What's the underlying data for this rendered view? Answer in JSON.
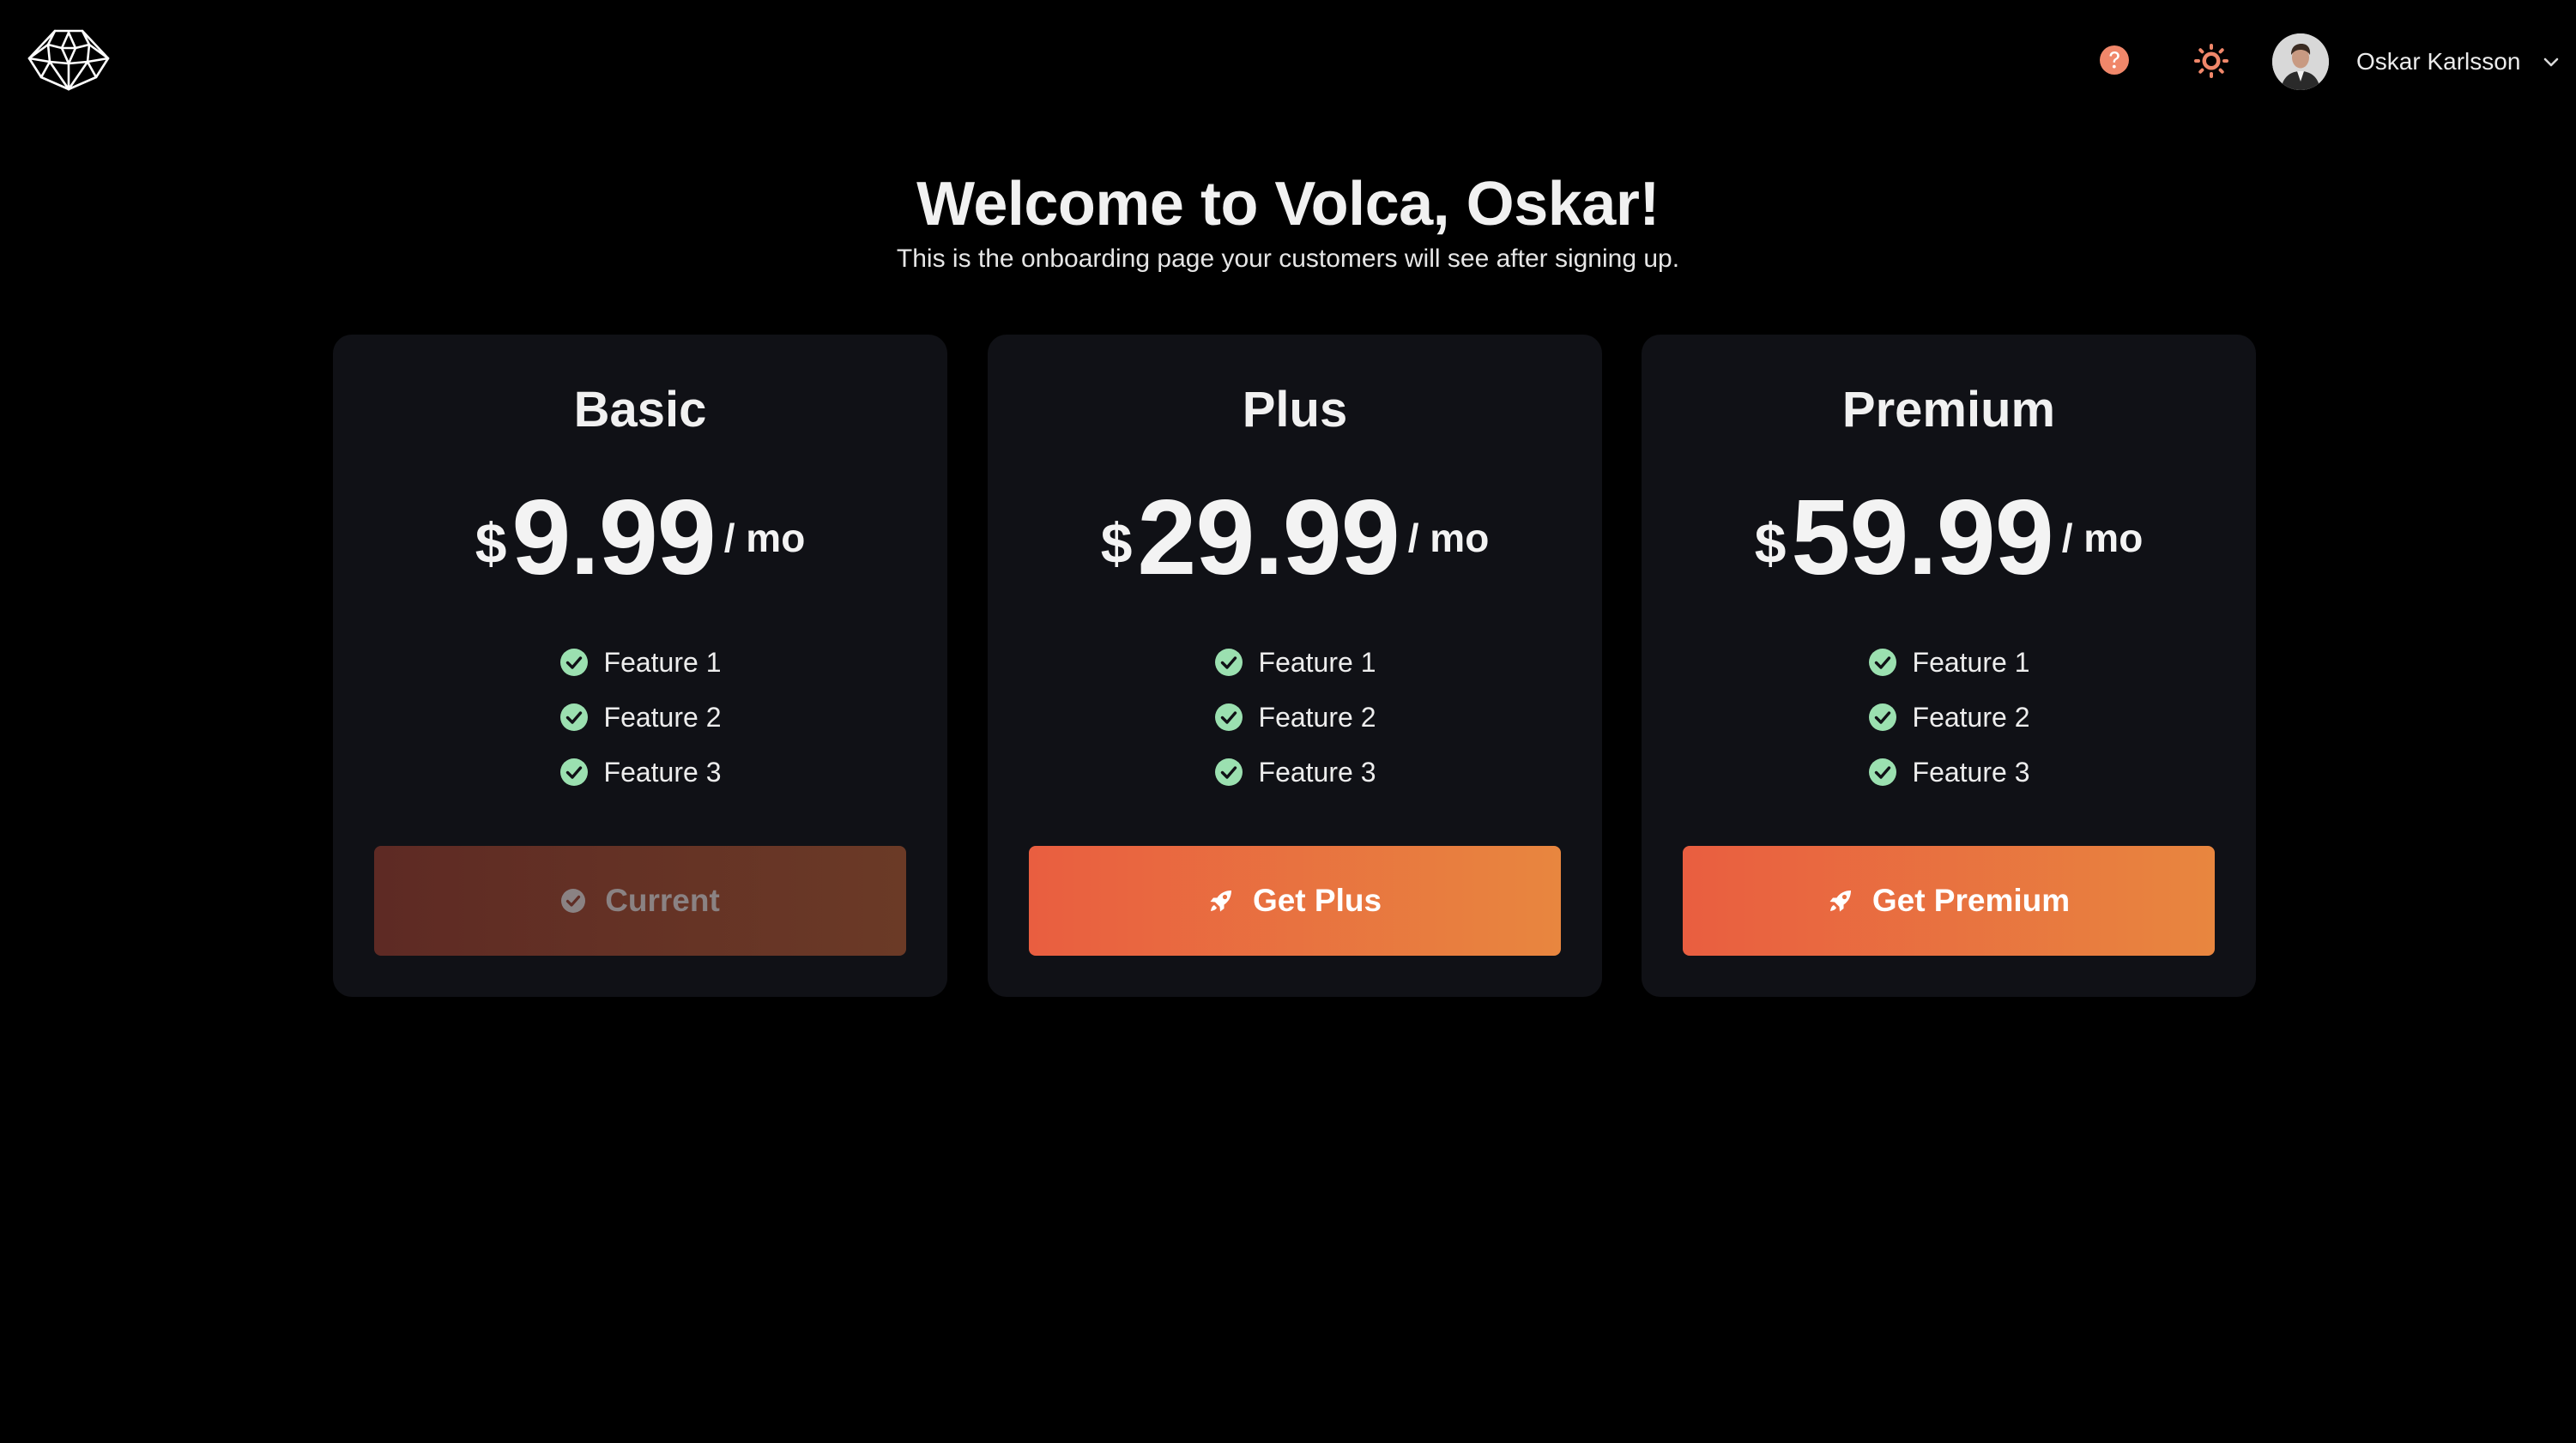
{
  "header": {
    "user_name": "Oskar Karlsson",
    "accent_color": "#f08c6c"
  },
  "main": {
    "title": "Welcome to Volca, Oskar!",
    "subtitle": "This is the onboarding page your customers will see after signing up."
  },
  "plans": [
    {
      "name": "Basic",
      "currency": "$",
      "price": "9.99",
      "period": "/ mo",
      "features": [
        "Feature 1",
        "Feature 2",
        "Feature 3"
      ],
      "button_label": "Current",
      "button_icon": "check-circle-icon",
      "is_current": true
    },
    {
      "name": "Plus",
      "currency": "$",
      "price": "29.99",
      "period": "/ mo",
      "features": [
        "Feature 1",
        "Feature 2",
        "Feature 3"
      ],
      "button_label": "Get Plus",
      "button_icon": "rocket-icon",
      "is_current": false
    },
    {
      "name": "Premium",
      "currency": "$",
      "price": "59.99",
      "period": "/ mo",
      "features": [
        "Feature 1",
        "Feature 2",
        "Feature 3"
      ],
      "button_label": "Get Premium",
      "button_icon": "rocket-icon",
      "is_current": false
    }
  ],
  "colors": {
    "background": "#000000",
    "card": "#101116",
    "check_green": "#9be0b0",
    "button_gradient_start": "#e95e40",
    "button_gradient_end": "#e8863f",
    "current_gradient_start": "#5e2a24",
    "current_gradient_end": "#6b3a26"
  }
}
